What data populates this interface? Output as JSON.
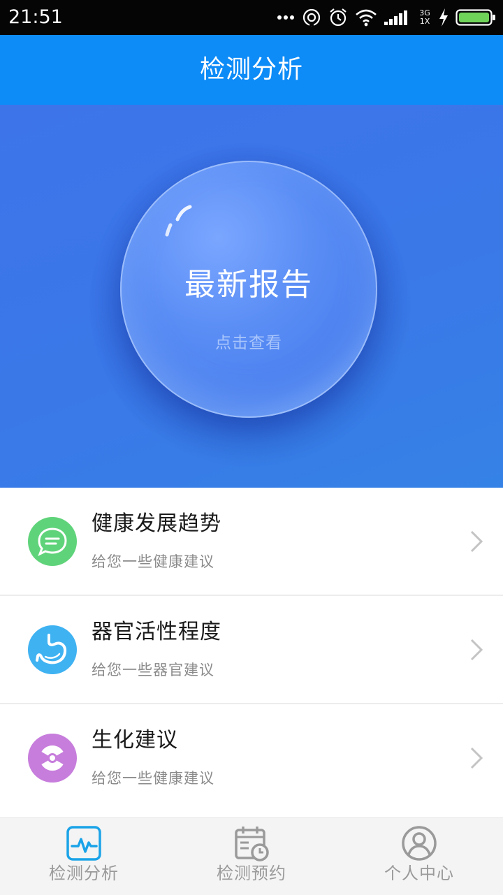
{
  "status_bar": {
    "time": "21:51",
    "network_top": "3G",
    "network_bottom": "1X",
    "icons": [
      "more-dots-icon",
      "sync-icon",
      "alarm-icon",
      "wifi-icon",
      "signal-icon",
      "charging-icon",
      "battery-icon"
    ]
  },
  "header": {
    "title": "检测分析"
  },
  "hero": {
    "title": "最新报告",
    "subtitle": "点击查看"
  },
  "list": {
    "items": [
      {
        "title": "健康发展趋势",
        "subtitle": "给您一些健康建议",
        "icon": "chat-bubble-icon",
        "color": "#5fd37a"
      },
      {
        "title": "器官活性程度",
        "subtitle": "给您一些器官建议",
        "icon": "stomach-icon",
        "color": "#3fb2f2"
      },
      {
        "title": "生化建议",
        "subtitle": "给您一些健康建议",
        "icon": "radiation-icon",
        "color": "#c77ddc"
      }
    ]
  },
  "tab_bar": {
    "tabs": [
      {
        "label": "检测分析",
        "icon": "activity-monitor-icon",
        "active": true
      },
      {
        "label": "检测预约",
        "icon": "calendar-clock-icon",
        "active": false
      },
      {
        "label": "个人中心",
        "icon": "user-icon",
        "active": false
      }
    ]
  },
  "colors": {
    "header_bg": "#0d8bf7",
    "hero_bg": "#3a78e8",
    "active_tab_icon": "#1aa3e8",
    "inactive_tab": "#9a9a9a"
  }
}
